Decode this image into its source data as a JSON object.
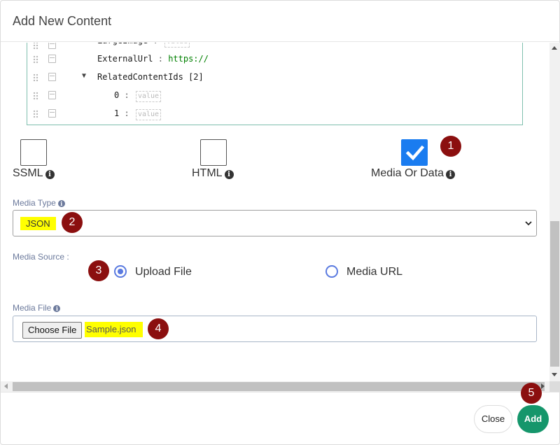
{
  "dialog": {
    "title": "Add New Content"
  },
  "json_editor": {
    "rows": [
      {
        "key": "LargeImage",
        "value_placeholder": "value"
      },
      {
        "key": "ExternalUrl",
        "value": "https://"
      },
      {
        "key": "RelatedContentIds",
        "count": "[2]",
        "expanded": true
      },
      {
        "key": "0",
        "value_placeholder": "value"
      },
      {
        "key": "1",
        "value_placeholder": "value"
      }
    ],
    "separator": ":"
  },
  "content_types": [
    {
      "label": "SSML",
      "checked": false
    },
    {
      "label": "HTML",
      "checked": false
    },
    {
      "label": "Media Or Data",
      "checked": true
    }
  ],
  "media_type": {
    "label": "Media Type",
    "value": "JSON"
  },
  "media_source": {
    "label": "Media Source :",
    "options": [
      {
        "label": "Upload File",
        "selected": true
      },
      {
        "label": "Media URL",
        "selected": false
      }
    ]
  },
  "media_file": {
    "label": "Media File",
    "button_label": "Choose File",
    "file_name": "Sample.json"
  },
  "badges": [
    "1",
    "2",
    "3",
    "4",
    "5"
  ],
  "footer": {
    "close_label": "Close",
    "add_label": "Add"
  },
  "colors": {
    "accent": "#1a7cf0",
    "add_button": "#15966b",
    "badge": "#8b0f0f",
    "highlight": "#ffff00"
  },
  "icons": {
    "info": "info-circle-icon",
    "check": "check-icon",
    "chevron": "chevron-down-icon"
  }
}
